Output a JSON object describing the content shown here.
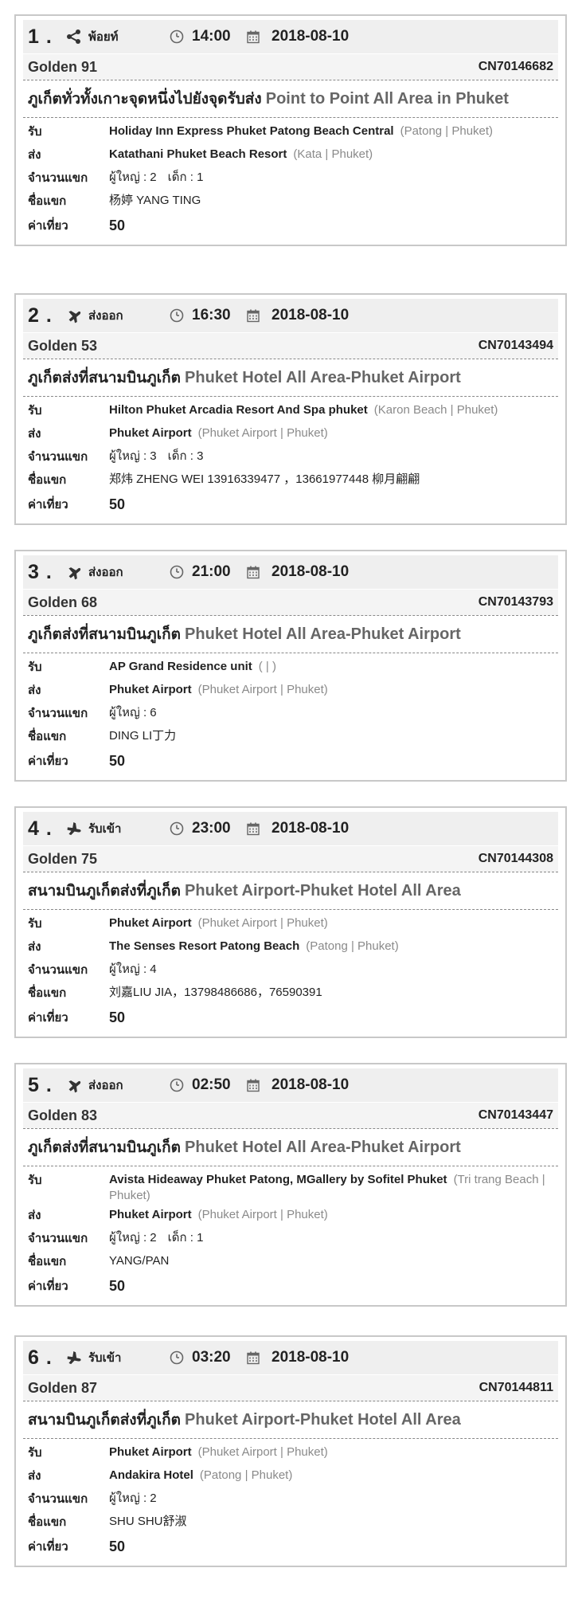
{
  "labels": {
    "pickup": "รับ",
    "dropoff": "ส่ง",
    "passengers": "จำนวนแขก",
    "guest_name": "ชื่อแขก",
    "fare": "ค่าเที่ยว"
  },
  "jobs": [
    {
      "num": "1 .",
      "icon": "share-icon",
      "type": "พ้อยท์",
      "time": "14:00",
      "date": "2018-08-10",
      "car": "Golden 91",
      "order": "CN70146682",
      "title_th": "ภูเก็ตทั่วทั้งเกาะจุดหนึ่งไปยังจุดรับส่ง",
      "title_en": "Point to Point All Area in Phuket",
      "pickup_place": "Holiday Inn Express Phuket Patong Beach Central",
      "pickup_area": "(Patong | Phuket)",
      "dropoff_place": "Katathani Phuket Beach Resort",
      "dropoff_area": "(Kata | Phuket)",
      "adults": "ผู้ใหญ่ : 2",
      "kids": "เด็ก : 1",
      "guest": "杨婷 YANG TING",
      "fare": "50"
    },
    {
      "num": "2 .",
      "icon": "plane-departure-icon",
      "type": "ส่งออก",
      "time": "16:30",
      "date": "2018-08-10",
      "car": "Golden 53",
      "order": "CN70143494",
      "title_th": "ภูเก็ตส่งที่สนามบินภูเก็ต",
      "title_en": "Phuket Hotel All Area-Phuket Airport",
      "pickup_place": "Hilton Phuket Arcadia Resort And Spa phuket",
      "pickup_area": "(Karon Beach | Phuket)",
      "dropoff_place": "Phuket Airport",
      "dropoff_area": "(Phuket Airport | Phuket)",
      "adults": "ผู้ใหญ่ : 3",
      "kids": "เด็ก : 3",
      "guest": "郑炜 ZHENG WEI 13916339477 ，13661977448 柳月翩翩",
      "fare": "50"
    },
    {
      "num": "3 .",
      "icon": "plane-departure-icon",
      "type": "ส่งออก",
      "time": "21:00",
      "date": "2018-08-10",
      "car": "Golden 68",
      "order": "CN70143793",
      "title_th": "ภูเก็ตส่งที่สนามบินภูเก็ต",
      "title_en": "Phuket Hotel All Area-Phuket Airport",
      "pickup_place": "AP Grand Residence unit",
      "pickup_area": "( | )",
      "dropoff_place": "Phuket Airport",
      "dropoff_area": "(Phuket Airport | Phuket)",
      "adults": "ผู้ใหญ่ : 6",
      "kids": "",
      "guest": "DING LI丁力",
      "fare": "50"
    },
    {
      "num": "4 .",
      "icon": "plane-arrival-icon",
      "type": "รับเข้า",
      "time": "23:00",
      "date": "2018-08-10",
      "car": "Golden 75",
      "order": "CN70144308",
      "title_th": "สนามบินภูเก็ตส่งที่ภูเก็ต",
      "title_en": "Phuket Airport-Phuket Hotel All Area",
      "pickup_place": "Phuket Airport",
      "pickup_area": "(Phuket Airport | Phuket)",
      "dropoff_place": "The Senses Resort Patong Beach",
      "dropoff_area": "(Patong | Phuket)",
      "adults": "ผู้ใหญ่ : 4",
      "kids": "",
      "guest": "刘嘉LIU JIA，13798486686，76590391",
      "fare": "50"
    },
    {
      "num": "5 .",
      "icon": "plane-departure-icon",
      "type": "ส่งออก",
      "time": "02:50",
      "date": "2018-08-10",
      "car": "Golden 83",
      "order": "CN70143447",
      "title_th": "ภูเก็ตส่งที่สนามบินภูเก็ต",
      "title_en": "Phuket Hotel All Area-Phuket Airport",
      "pickup_place": "Avista Hideaway Phuket Patong, MGallery by Sofitel Phuket",
      "pickup_area": "(Tri trang Beach | Phuket)",
      "dropoff_place": "Phuket Airport",
      "dropoff_area": "(Phuket Airport | Phuket)",
      "adults": "ผู้ใหญ่ : 2",
      "kids": "เด็ก : 1",
      "guest": "YANG/PAN",
      "fare": "50"
    },
    {
      "num": "6 .",
      "icon": "plane-arrival-icon",
      "type": "รับเข้า",
      "time": "03:20",
      "date": "2018-08-10",
      "car": "Golden 87",
      "order": "CN70144811",
      "title_th": "สนามบินภูเก็ตส่งที่ภูเก็ต",
      "title_en": "Phuket Airport-Phuket Hotel All Area",
      "pickup_place": "Phuket Airport",
      "pickup_area": "(Phuket Airport | Phuket)",
      "dropoff_place": "Andakira Hotel",
      "dropoff_area": "(Patong | Phuket)",
      "adults": "ผู้ใหญ่ : 2",
      "kids": "",
      "guest": "SHU SHU舒淑",
      "fare": "50"
    }
  ]
}
